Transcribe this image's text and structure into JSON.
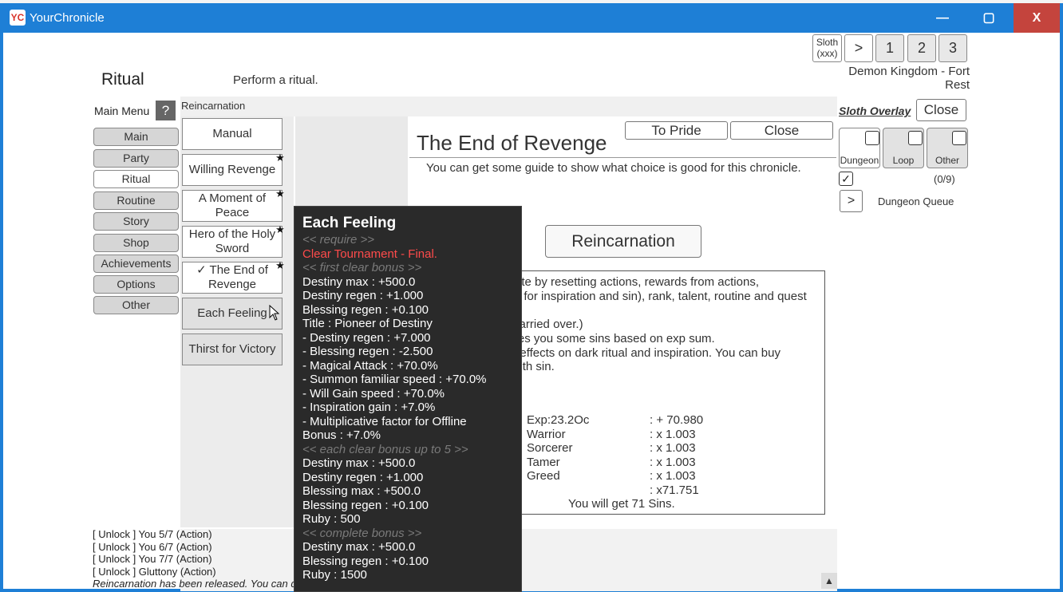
{
  "window": {
    "title": "YourChronicle",
    "app_icon": "YC",
    "minimize": "—",
    "maximize": "▢",
    "close": "X"
  },
  "topnav": {
    "sloth_line1": "Sloth",
    "sloth_line2": "(xxx)",
    "next": ">",
    "p1": "1",
    "p2": "2",
    "p3": "3"
  },
  "location": {
    "line1": "Demon Kingdom - Fort",
    "line2": "Rest"
  },
  "page": {
    "title": "Ritual",
    "description": "Perform a ritual."
  },
  "menu": {
    "header": "Main Menu",
    "help": "?",
    "items": [
      "Main",
      "Party",
      "Ritual",
      "Routine",
      "Story",
      "Shop",
      "Achievements",
      "Options",
      "Other"
    ],
    "active_index": 2
  },
  "breadcrumb": "Reincarnation",
  "rituals": [
    {
      "label": "Manual",
      "star": false
    },
    {
      "label": "Willing Revenge",
      "star": true
    },
    {
      "label": "A Moment of Peace",
      "star": true
    },
    {
      "label": "Hero of the Holy Sword",
      "star": true
    },
    {
      "label": "✓ The End of Revenge",
      "star": true
    },
    {
      "label": "Each Feeling",
      "star": false
    },
    {
      "label": "Thirst for Victory",
      "star": false
    }
  ],
  "star_glyph": "★",
  "detail": {
    "title": "The End of Revenge",
    "to_pride": "To Pride",
    "close": "Close",
    "guide": "You can get some guide to show what choice is good for this chronicle.",
    "action_button": "Reincarnation",
    "desc_lines": [
      "You can reincarnate by resetting actions, rewards from actions,",
      "resources (except for inspiration and sin), rank, talent, routine and quest",
      "effects.",
      "(Abilities can be carried over.)",
      "Reincarnation gives you some sins based on exp sum.",
      "Sin has multiplier effects on dark ritual and inspiration. You can buy",
      "some upgrades with sin."
    ],
    "exp_rows": [
      {
        "name": "Exp:23.2Oc",
        "value": ":  + 70.980"
      },
      {
        "name": "Warrior",
        "value": ":  x 1.003"
      },
      {
        "name": "Sorcerer",
        "value": ":  x 1.003"
      },
      {
        "name": "Tamer",
        "value": ":  x 1.003"
      },
      {
        "name": "Greed",
        "value": ":  x 1.003"
      },
      {
        "name": "",
        "value": ": x71.751"
      }
    ],
    "sins": "You will get 71 Sins."
  },
  "overlay": {
    "label": "Sloth Overlay",
    "close": "Close",
    "tiles": [
      "Dungeon",
      "Loop",
      "Other"
    ],
    "count": "(0/9)",
    "queue_button": ">",
    "queue_label": "Dungeon Queue",
    "check_glyph": "✓"
  },
  "log": [
    "[ Unlock ] You 5/7 (Action)",
    "[ Unlock ] You 6/7 (Action)",
    "[ Unlock ] You 7/7 (Action)",
    "[ Unlock ] Gluttony (Action)",
    "Reincarnation has been released. You can do it in Ritual screen."
  ],
  "scroll_up": "▲",
  "tooltip": {
    "title": "Each Feeling",
    "lines": [
      {
        "text": "<< require >>",
        "kind": "hdr"
      },
      {
        "text": "Clear Tournament - Final.",
        "kind": "red"
      },
      {
        "text": "<< first clear bonus >>",
        "kind": "hdr"
      },
      {
        "text": "Destiny max : +500.0",
        "kind": ""
      },
      {
        "text": "Destiny regen : +1.000",
        "kind": ""
      },
      {
        "text": "Blessing regen : +0.100",
        "kind": ""
      },
      {
        "text": "Title : Pioneer of Destiny",
        "kind": ""
      },
      {
        "text": " - Destiny regen : +7.000",
        "kind": ""
      },
      {
        "text": " - Blessing regen : -2.500",
        "kind": ""
      },
      {
        "text": " - Magical Attack : +70.0%",
        "kind": ""
      },
      {
        "text": " - Summon familiar speed : +70.0%",
        "kind": ""
      },
      {
        "text": " - Will Gain speed : +70.0%",
        "kind": ""
      },
      {
        "text": " - Inspiration gain : +7.0%",
        "kind": ""
      },
      {
        "text": " - Multiplicative factor for Offline",
        "kind": ""
      },
      {
        "text": "Bonus : +7.0%",
        "kind": ""
      },
      {
        "text": "<< each clear bonus up to 5 >>",
        "kind": "hdr"
      },
      {
        "text": "Destiny max : +500.0",
        "kind": ""
      },
      {
        "text": "Destiny regen : +1.000",
        "kind": ""
      },
      {
        "text": "Blessing max : +500.0",
        "kind": ""
      },
      {
        "text": "Blessing regen : +0.100",
        "kind": ""
      },
      {
        "text": "Ruby : 500",
        "kind": ""
      },
      {
        "text": "<< complete bonus >>",
        "kind": "hdr"
      },
      {
        "text": "Destiny max : +500.0",
        "kind": ""
      },
      {
        "text": "Blessing regen : +0.100",
        "kind": ""
      },
      {
        "text": "Ruby : 1500",
        "kind": ""
      }
    ]
  }
}
